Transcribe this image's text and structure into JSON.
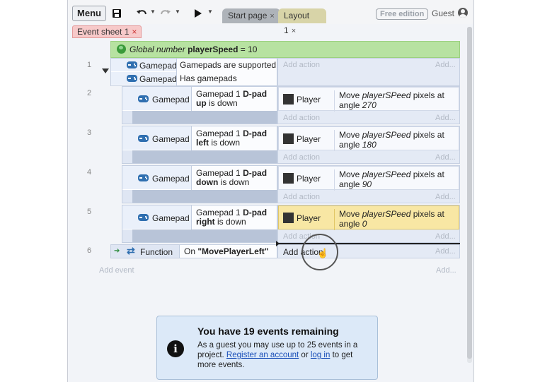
{
  "toolbar": {
    "menu_label": "Menu",
    "tabs": [
      {
        "label": "Start page",
        "close": "×"
      },
      {
        "label": "Layout 1",
        "close": "×"
      }
    ],
    "free_edition": "Free edition",
    "user": "Guest"
  },
  "sheet_tab": {
    "label": "Event sheet 1",
    "close": "×"
  },
  "global_var": {
    "prefix": "Global number",
    "name": "playerSpeed",
    "value": "= 10"
  },
  "add_action": "Add action",
  "add_dots": "Add...",
  "add_event": "Add event",
  "events": [
    {
      "number": "1",
      "conditions": [
        {
          "object": "Gamepad",
          "text": "Gamepads are supported"
        },
        {
          "object": "Gamepad",
          "text": "Has gamepads"
        }
      ]
    },
    {
      "number": "2",
      "object": "Gamepad",
      "cond_pre": "Gamepad 1",
      "cond_bold": "D-pad up",
      "cond_post": "is down",
      "action_object": "Player",
      "action_pre": "Move",
      "action_var": "playerSPeed",
      "action_mid": "pixels at angle",
      "action_angle": "270"
    },
    {
      "number": "3",
      "object": "Gamepad",
      "cond_pre": "Gamepad 1",
      "cond_bold": "D-pad left",
      "cond_post": "is down",
      "action_object": "Player",
      "action_pre": "Move",
      "action_var": "playerSPeed",
      "action_mid": "pixels at angle",
      "action_angle": "180"
    },
    {
      "number": "4",
      "object": "Gamepad",
      "cond_pre": "Gamepad 1",
      "cond_bold": "D-pad down",
      "cond_post": "is down",
      "action_object": "Player",
      "action_pre": "Move",
      "action_var": "playerSPeed",
      "action_mid": "pixels at angle",
      "action_angle": "90"
    },
    {
      "number": "5",
      "object": "Gamepad",
      "cond_pre": "Gamepad 1",
      "cond_bold": "D-pad right",
      "cond_post": "is down",
      "action_object": "Player",
      "action_pre": "Move",
      "action_var": "playerSPeed",
      "action_mid": "pixels at angle",
      "action_angle": "0"
    },
    {
      "number": "6",
      "object": "Function",
      "cond_pre": "On",
      "cond_bold": "\"MovePlayerLeft\""
    }
  ],
  "notice": {
    "title": "You have 19 events remaining",
    "body_1": "As a guest you may use up to 25 events in a project.",
    "link_register": "Register an account",
    "body_or": "or",
    "link_login": "log in",
    "body_2": "to get more events.",
    "icon_glyph": "i"
  },
  "icons": {
    "save": "save-icon",
    "undo": "undo-icon",
    "redo": "redo-icon",
    "play": "play-icon",
    "gamepad": "gamepad-icon",
    "function": "function-icon",
    "globe": "globe-icon",
    "info": "info-icon"
  }
}
